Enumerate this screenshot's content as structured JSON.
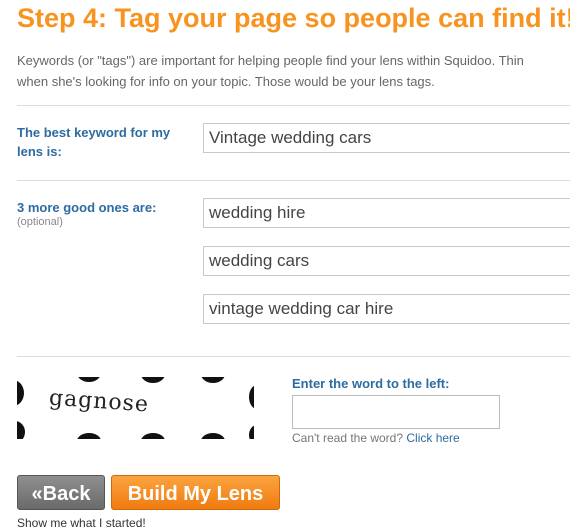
{
  "step": {
    "title": "Step 4: Tag your page so people can find it!",
    "intro_line1": "Keywords (or \"tags\") are important for helping people find your lens within Squidoo. Thin",
    "intro_line2": "when she's looking for info on your topic. Those would be your lens tags."
  },
  "keywords": {
    "best_label": "The best keyword for my lens is:",
    "best_value": "Vintage wedding cars",
    "more_label": "3 more good ones are:",
    "optional_label": "(optional)",
    "more_values": [
      "wedding hire",
      "wedding cars",
      "vintage wedding car hire"
    ]
  },
  "captcha": {
    "word": "gagnose",
    "label": "Enter the word to the left:",
    "cant_read": "Can't read the word?",
    "click_here": "Click here",
    "input_value": ""
  },
  "buttons": {
    "back_label": "«Back",
    "build_label": "Build My Lens"
  },
  "footer": {
    "show_me": "Show me what I started!"
  }
}
